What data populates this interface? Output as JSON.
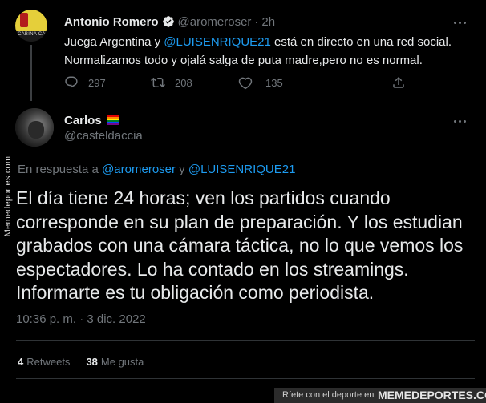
{
  "watermark_side": "Memedeportes.com",
  "tweet1": {
    "name": "Antonio Romero",
    "handle": "@aromeroser",
    "separator": "·",
    "time": "2h",
    "avatar_caption": "CABINA CA",
    "body_prefix": "Juega Argentina y ",
    "body_mention": "@LUISENRIQUE21",
    "body_rest": " está en directo en una red social. Normalizamos todo y ojalá salga de puta madre,pero no es normal.",
    "actions": {
      "replies": "297",
      "retweets": "208",
      "likes": "135"
    }
  },
  "tweet2": {
    "name": "Carlos",
    "handle": "@casteldaccia",
    "reply_prefix": "En respuesta a ",
    "reply_mention1": "@aromeroser",
    "reply_and": " y ",
    "reply_mention2": "@LUISENRIQUE21",
    "body": "El día tiene 24 horas; ven los partidos cuando corresponde en su plan de preparación. Y los estudian grabados con una cámara táctica, no lo que vemos los espectadores. Lo ha contado en los streamings. Informarte es tu obligación como periodista.",
    "timestamp": "10:36 p. m. · 3 dic. 2022",
    "retweets_count": "4",
    "retweets_label": "Retweets",
    "likes_count": "38",
    "likes_label": "Me gusta"
  },
  "footer": {
    "tagline": "Ríete con el deporte en",
    "brand": "MEMEDEPORTES.COM"
  },
  "colors": {
    "background": "#000000",
    "text": "#e7e9ea",
    "muted": "#71767b",
    "accent": "#1d9bf0",
    "divider": "#2f3336"
  }
}
